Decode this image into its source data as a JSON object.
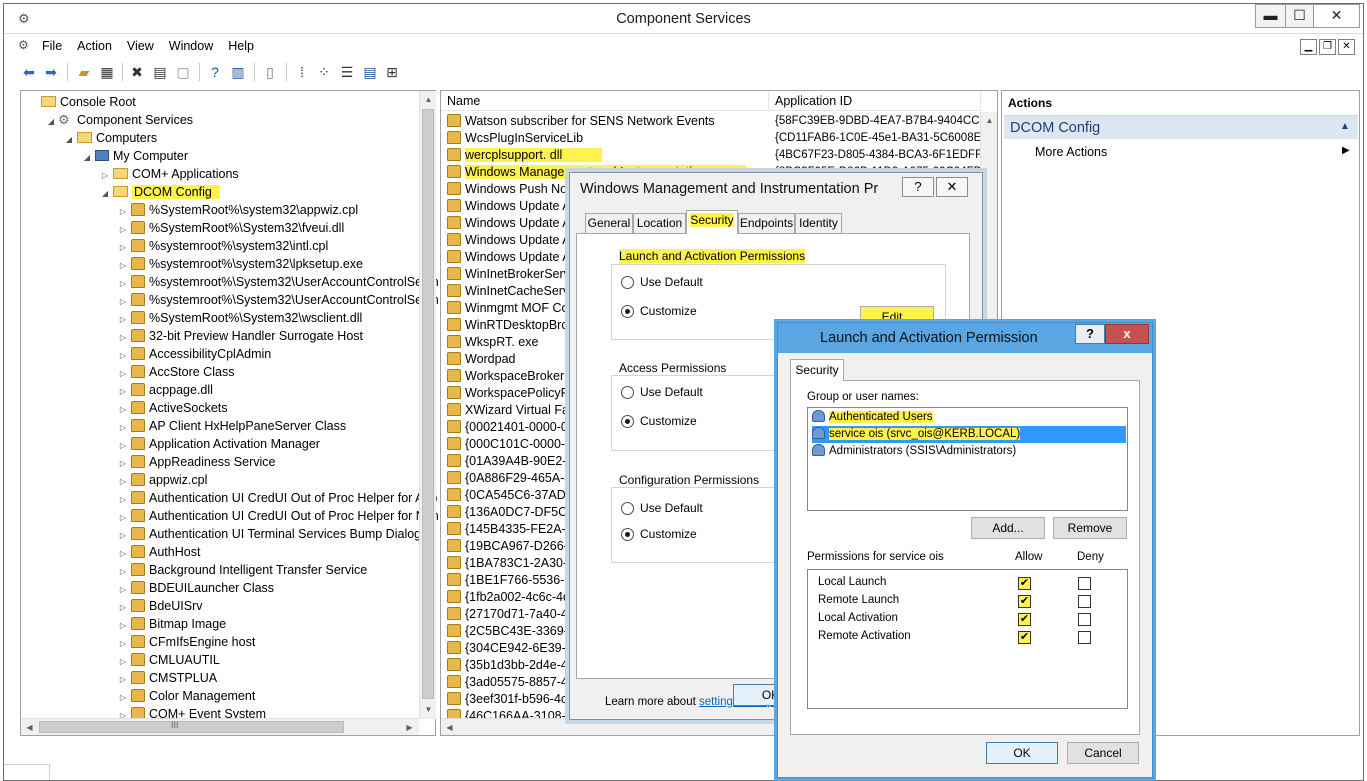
{
  "window": {
    "title": "Component Services",
    "minimize": "▬",
    "maximize": "☐",
    "close": "✕"
  },
  "menu": [
    "File",
    "Action",
    "View",
    "Window",
    "Help"
  ],
  "mdi": {
    "minimize": "▁",
    "restore": "❐",
    "close": "✕"
  },
  "tree": [
    {
      "label": "Console Root",
      "indent": 0,
      "icon": "folder-icon",
      "expander": ""
    },
    {
      "label": "Component Services",
      "indent": 1,
      "icon": "gear-icon",
      "expander": "◢"
    },
    {
      "label": "Computers",
      "indent": 2,
      "icon": "folder-icon",
      "expander": "◢"
    },
    {
      "label": "My Computer",
      "indent": 3,
      "icon": "computer-icon",
      "expander": "◢"
    },
    {
      "label": "COM+ Applications",
      "indent": 4,
      "icon": "folder-icon",
      "expander": "▷"
    },
    {
      "label": "DCOM Config",
      "indent": 4,
      "icon": "folder-icon",
      "expander": "◢",
      "highlight": true
    },
    {
      "label": "%SystemRoot%\\system32\\appwiz.cpl",
      "indent": 5,
      "icon": "package-icon",
      "expander": "▷"
    },
    {
      "label": "%SystemRoot%\\System32\\fveui.dll",
      "indent": 5,
      "icon": "package-icon",
      "expander": "▷"
    },
    {
      "label": "%systemroot%\\system32\\intl.cpl",
      "indent": 5,
      "icon": "package-icon",
      "expander": "▷"
    },
    {
      "label": "%systemroot%\\system32\\lpksetup.exe",
      "indent": 5,
      "icon": "package-icon",
      "expander": "▷"
    },
    {
      "label": "%systemroot%\\System32\\UserAccountControlSettin",
      "indent": 5,
      "icon": "package-icon",
      "expander": "▷"
    },
    {
      "label": "%systemroot%\\System32\\UserAccountControlSettin",
      "indent": 5,
      "icon": "package-icon",
      "expander": "▷"
    },
    {
      "label": "%SystemRoot%\\System32\\wsclient.dll",
      "indent": 5,
      "icon": "package-icon",
      "expander": "▷"
    },
    {
      "label": "32-bit Preview Handler Surrogate Host",
      "indent": 5,
      "icon": "package-icon",
      "expander": "▷"
    },
    {
      "label": "AccessibilityCplAdmin",
      "indent": 5,
      "icon": "package-icon",
      "expander": "▷"
    },
    {
      "label": "AccStore Class",
      "indent": 5,
      "icon": "package-icon",
      "expander": "▷"
    },
    {
      "label": "acppage.dll",
      "indent": 5,
      "icon": "package-icon",
      "expander": "▷"
    },
    {
      "label": "ActiveSockets",
      "indent": 5,
      "icon": "package-icon",
      "expander": "▷"
    },
    {
      "label": "AP Client HxHelpPaneServer Class",
      "indent": 5,
      "icon": "package-icon",
      "expander": "▷"
    },
    {
      "label": "Application Activation Manager",
      "indent": 5,
      "icon": "package-icon",
      "expander": "▷"
    },
    {
      "label": "AppReadiness Service",
      "indent": 5,
      "icon": "package-icon",
      "expander": "▷"
    },
    {
      "label": "appwiz.cpl",
      "indent": 5,
      "icon": "package-icon",
      "expander": "▷"
    },
    {
      "label": "Authentication UI CredUI Out of Proc Helper for App",
      "indent": 5,
      "icon": "package-icon",
      "expander": "▷"
    },
    {
      "label": "Authentication UI CredUI Out of Proc Helper for Non",
      "indent": 5,
      "icon": "package-icon",
      "expander": "▷"
    },
    {
      "label": "Authentication UI Terminal Services Bump Dialog",
      "indent": 5,
      "icon": "package-icon",
      "expander": "▷"
    },
    {
      "label": "AuthHost",
      "indent": 5,
      "icon": "package-icon",
      "expander": "▷"
    },
    {
      "label": "Background Intelligent Transfer Service",
      "indent": 5,
      "icon": "package-icon",
      "expander": "▷"
    },
    {
      "label": "BDEUILauncher Class",
      "indent": 5,
      "icon": "package-icon",
      "expander": "▷"
    },
    {
      "label": "BdeUISrv",
      "indent": 5,
      "icon": "package-icon",
      "expander": "▷"
    },
    {
      "label": "Bitmap Image",
      "indent": 5,
      "icon": "package-icon",
      "expander": "▷"
    },
    {
      "label": "CFmIfsEngine host",
      "indent": 5,
      "icon": "package-icon",
      "expander": "▷"
    },
    {
      "label": "CMLUAUTIL",
      "indent": 5,
      "icon": "package-icon",
      "expander": "▷"
    },
    {
      "label": "CMSTPLUA",
      "indent": 5,
      "icon": "package-icon",
      "expander": "▷"
    },
    {
      "label": "Color Management",
      "indent": 5,
      "icon": "package-icon",
      "expander": "▷"
    },
    {
      "label": "COM+ Event System",
      "indent": 5,
      "icon": "package-icon",
      "expander": "▷"
    }
  ],
  "list": {
    "columns": [
      "Name",
      "Application ID"
    ],
    "rows": [
      {
        "name": "Watson subscriber for SENS Network Events",
        "id": "{58FC39EB-9DBD-4EA7-B7B4-9404CC6"
      },
      {
        "name": "WcsPlugInServiceLib",
        "id": "{CD11FAB6-1C0E-45e1-BA31-5C6008EF"
      },
      {
        "name": "wercplsupport. dll",
        "id": "{4BC67F23-D805-4384-BCA3-6F1EDFF5",
        "highlight": true
      },
      {
        "name": "Windows Management and Instrumentation",
        "id": "{8BC3F05E-D86B-11D0-A075-00C04FB6",
        "highlight": true
      },
      {
        "name": "Windows Push Notifi",
        "id": ""
      },
      {
        "name": "Windows Update Age",
        "id": ""
      },
      {
        "name": "Windows Update Age",
        "id": ""
      },
      {
        "name": "Windows Update Age",
        "id": ""
      },
      {
        "name": "Windows Update Age",
        "id": ""
      },
      {
        "name": "WinInetBrokerServer",
        "id": ""
      },
      {
        "name": "WinInetCacheServer",
        "id": ""
      },
      {
        "name": "Winmgmt MOF Com",
        "id": ""
      },
      {
        "name": "WinRTDesktopBroker",
        "id": ""
      },
      {
        "name": "WkspRT. exe",
        "id": ""
      },
      {
        "name": "Wordpad",
        "id": ""
      },
      {
        "name": "WorkspaceBroker Cla",
        "id": ""
      },
      {
        "name": "WorkspacePolicyProc",
        "id": ""
      },
      {
        "name": "XWizard Virtual Facto",
        "id": ""
      },
      {
        "name": "{00021401-0000-0000",
        "id": ""
      },
      {
        "name": "{000C101C-0000-0000",
        "id": ""
      },
      {
        "name": "{01A39A4B-90E2-4ED",
        "id": ""
      },
      {
        "name": "{0A886F29-465A-4aea",
        "id": ""
      },
      {
        "name": "{0CA545C6-37AD-4A",
        "id": ""
      },
      {
        "name": "{136A0DC7-DF5C-42",
        "id": ""
      },
      {
        "name": "{145B4335-FE2A-4927",
        "id": ""
      },
      {
        "name": "{19BCA967-D266-436",
        "id": ""
      },
      {
        "name": "{1BA783C1-2A30-4ac",
        "id": ""
      },
      {
        "name": "{1BE1F766-5536-11D",
        "id": ""
      },
      {
        "name": "{1fb2a002-4c6c-4de7",
        "id": ""
      },
      {
        "name": "{27170d71-7a40-4c8b",
        "id": ""
      },
      {
        "name": "{2C5BC43E-3369-4C3",
        "id": ""
      },
      {
        "name": "{304CE942-6E39-40D8",
        "id": ""
      },
      {
        "name": "{35b1d3bb-2d4e-4a7",
        "id": ""
      },
      {
        "name": "{3ad05575-8857-4850",
        "id": ""
      },
      {
        "name": "{3eef301f-b596-4c0b",
        "id": ""
      },
      {
        "name": "{46C166AA-3108-11D",
        "id": ""
      }
    ]
  },
  "actions": {
    "title": "Actions",
    "group": "DCOM Config",
    "group_arrow": "▲",
    "more": "More Actions",
    "more_arrow": "▶"
  },
  "props_dialog": {
    "title": "Windows Management and Instrumentation Pr",
    "help": "?",
    "close": "✕",
    "tabs": [
      "General",
      "Location",
      "Security",
      "Endpoints",
      "Identity"
    ],
    "active_tab": "Security",
    "launch_group": "Launch and Activation Permissions",
    "access_group": "Access Permissions",
    "config_group": "Configuration Permissions",
    "use_default": "Use Default",
    "customize": "Customize",
    "edit_button": "Edit...",
    "learn_text": "Learn more about ",
    "learn_link": "setting these proper",
    "ok": "OK"
  },
  "perm_dialog": {
    "title": "Launch and Activation Permission",
    "help": "?",
    "close": "x",
    "tab": "Security",
    "group_label": "Group or user names:",
    "users": [
      "Authenticated Users",
      "service ois (srvc_ois@KERB.LOCAL)",
      "Administrators (SSIS\\Administrators)"
    ],
    "selected_user_index": 1,
    "add_button": "Add...",
    "remove_button": "Remove",
    "permissions_label": "Permissions for service ois",
    "allow_label": "Allow",
    "deny_label": "Deny",
    "permissions": [
      {
        "name": "Local Launch",
        "allow": true,
        "deny": false
      },
      {
        "name": "Remote Launch",
        "allow": true,
        "deny": false
      },
      {
        "name": "Local Activation",
        "allow": true,
        "deny": false
      },
      {
        "name": "Remote Activation",
        "allow": true,
        "deny": false
      }
    ],
    "ok_button": "OK",
    "cancel_button": "Cancel"
  },
  "icons": {
    "check": "✔",
    "app": "⚙",
    "tri_collapsed": "▷",
    "tri_expanded": "◢"
  },
  "scrollbar": {
    "up": "▲",
    "down": "▼",
    "left": "◀",
    "right": "▶",
    "grip": "III"
  }
}
